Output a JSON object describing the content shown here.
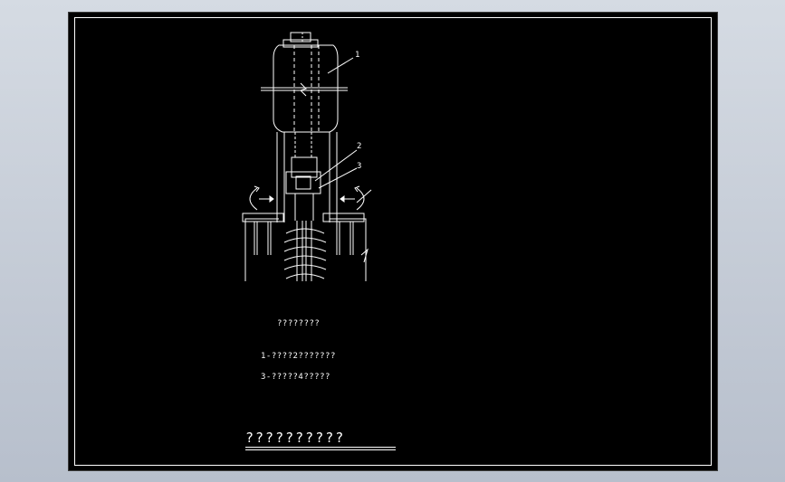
{
  "drawing": {
    "callouts": {
      "c1": "1",
      "c2": "2",
      "c3": "3"
    },
    "notes": {
      "caption": "????????",
      "line1": "1-????2???????",
      "line2": "3-?????4?????"
    },
    "title": "??????????"
  },
  "colors": {
    "background": "#000000",
    "line": "#ffffff"
  }
}
